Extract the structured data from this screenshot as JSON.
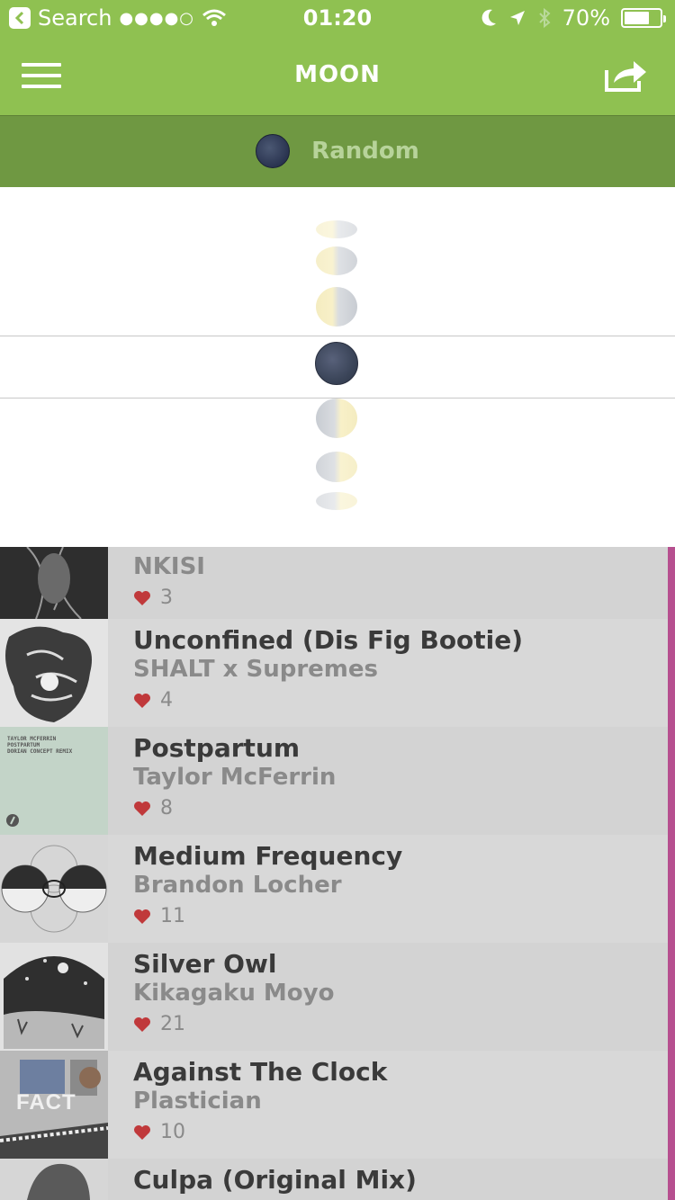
{
  "status_bar": {
    "back_label": "Search",
    "signal": "●●●●○",
    "time": "01:20",
    "battery_text": "70%",
    "battery_level": 0.7
  },
  "nav": {
    "title": "MOON"
  },
  "filter": {
    "label": "Random"
  },
  "picker": {
    "phases": [
      "waxing-crescent-top",
      "waxing-crescent",
      "first-quarter",
      "new-moon",
      "last-quarter",
      "waning-crescent",
      "waning-crescent-bottom"
    ],
    "selected": "new-moon"
  },
  "tracks": [
    {
      "title": "",
      "artist": "NKISI",
      "likes": "3"
    },
    {
      "title": "Unconfined (Dis Fig Bootie)",
      "artist": "SHALT x Supremes",
      "likes": "4"
    },
    {
      "title": "Postpartum",
      "artist": "Taylor McFerrin",
      "likes": "8",
      "cover_text": "TAYLOR MCFERRIN\nPOSTPARTUM\nDORIAN CONCEPT REMIX"
    },
    {
      "title": "Medium Frequency",
      "artist": "Brandon Locher",
      "likes": "11"
    },
    {
      "title": "Silver Owl",
      "artist": "Kikagaku Moyo",
      "likes": "21"
    },
    {
      "title": "Against The Clock",
      "artist": "Plastician",
      "likes": "10",
      "cover_text": "FACT"
    },
    {
      "title": "Culpa (Original Mix)",
      "artist": "",
      "likes": ""
    }
  ],
  "colors": {
    "accent_green": "#8fc151",
    "filter_green": "#6f9842",
    "heart_red": "#c0393b",
    "side_accent": "#b64f8f"
  }
}
